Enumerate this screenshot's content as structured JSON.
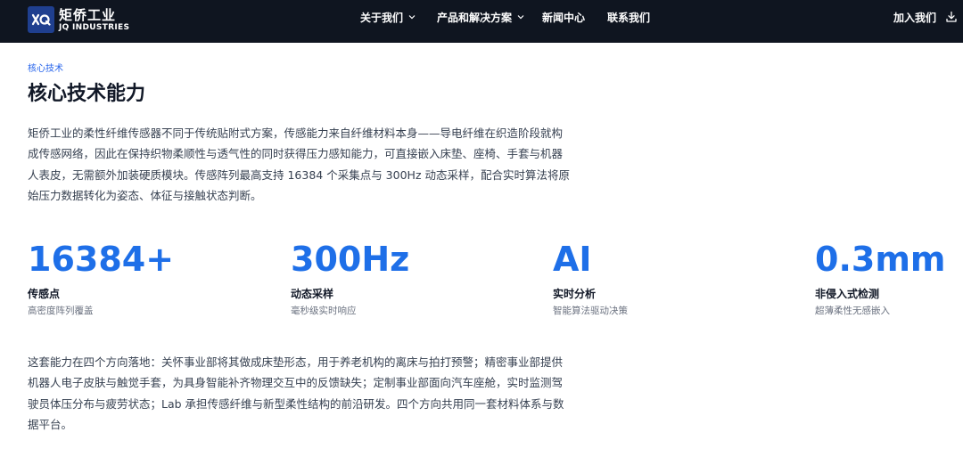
{
  "nav": {
    "logo_cn": "矩侨工业",
    "logo_en": "JQ INDUSTRIES",
    "items": [
      {
        "label": "关于我们",
        "has_dropdown": true
      },
      {
        "label": "产品和解决方案",
        "has_dropdown": true
      },
      {
        "label": "新闻中心",
        "has_dropdown": false
      },
      {
        "label": "联系我们",
        "has_dropdown": false
      }
    ],
    "join_label": "加入我们",
    "background": "#0f1520"
  },
  "section": {
    "eyebrow": "核心技术",
    "title": "核心技术能力",
    "intro": "矩侨工业的柔性纤维传感器不同于传统贴附式方案，传感能力来自纤维材料本身——导电纤维在织造阶段就构成传感网络，因此在保持织物柔顺性与透气性的同时获得压力感知能力，可直接嵌入床垫、座椅、手套与机器人表皮，无需额外加装硬质模块。传感阵列最高支持 16384 个采集点与 300Hz 动态采样，配合实时算法将原始压力数据转化为姿态、体征与接触状态判断。",
    "stats": [
      {
        "value": "16384+",
        "label": "传感点",
        "desc": "高密度阵列覆盖"
      },
      {
        "value": "300Hz",
        "label": "动态采样",
        "desc": "毫秒级实时响应"
      },
      {
        "value": "AI",
        "label": "实时分析",
        "desc": "智能算法驱动决策"
      },
      {
        "value": "0.3mm",
        "label": "非侵入式检测",
        "desc": "超薄柔性无感嵌入"
      }
    ],
    "outro": "这套能力在四个方向落地：关怀事业部将其做成床垫形态，用于养老机构的离床与拍打预警；精密事业部提供机器人电子皮肤与触觉手套，为具身智能补齐物理交互中的反馈缺失；定制事业部面向汽车座舱，实时监测驾驶员体压分布与疲劳状态；Lab 承担传感纤维与新型柔性结构的前沿研发。四个方向共用同一套材料体系与数据平台。",
    "accent_color": "#1e6fe8"
  }
}
